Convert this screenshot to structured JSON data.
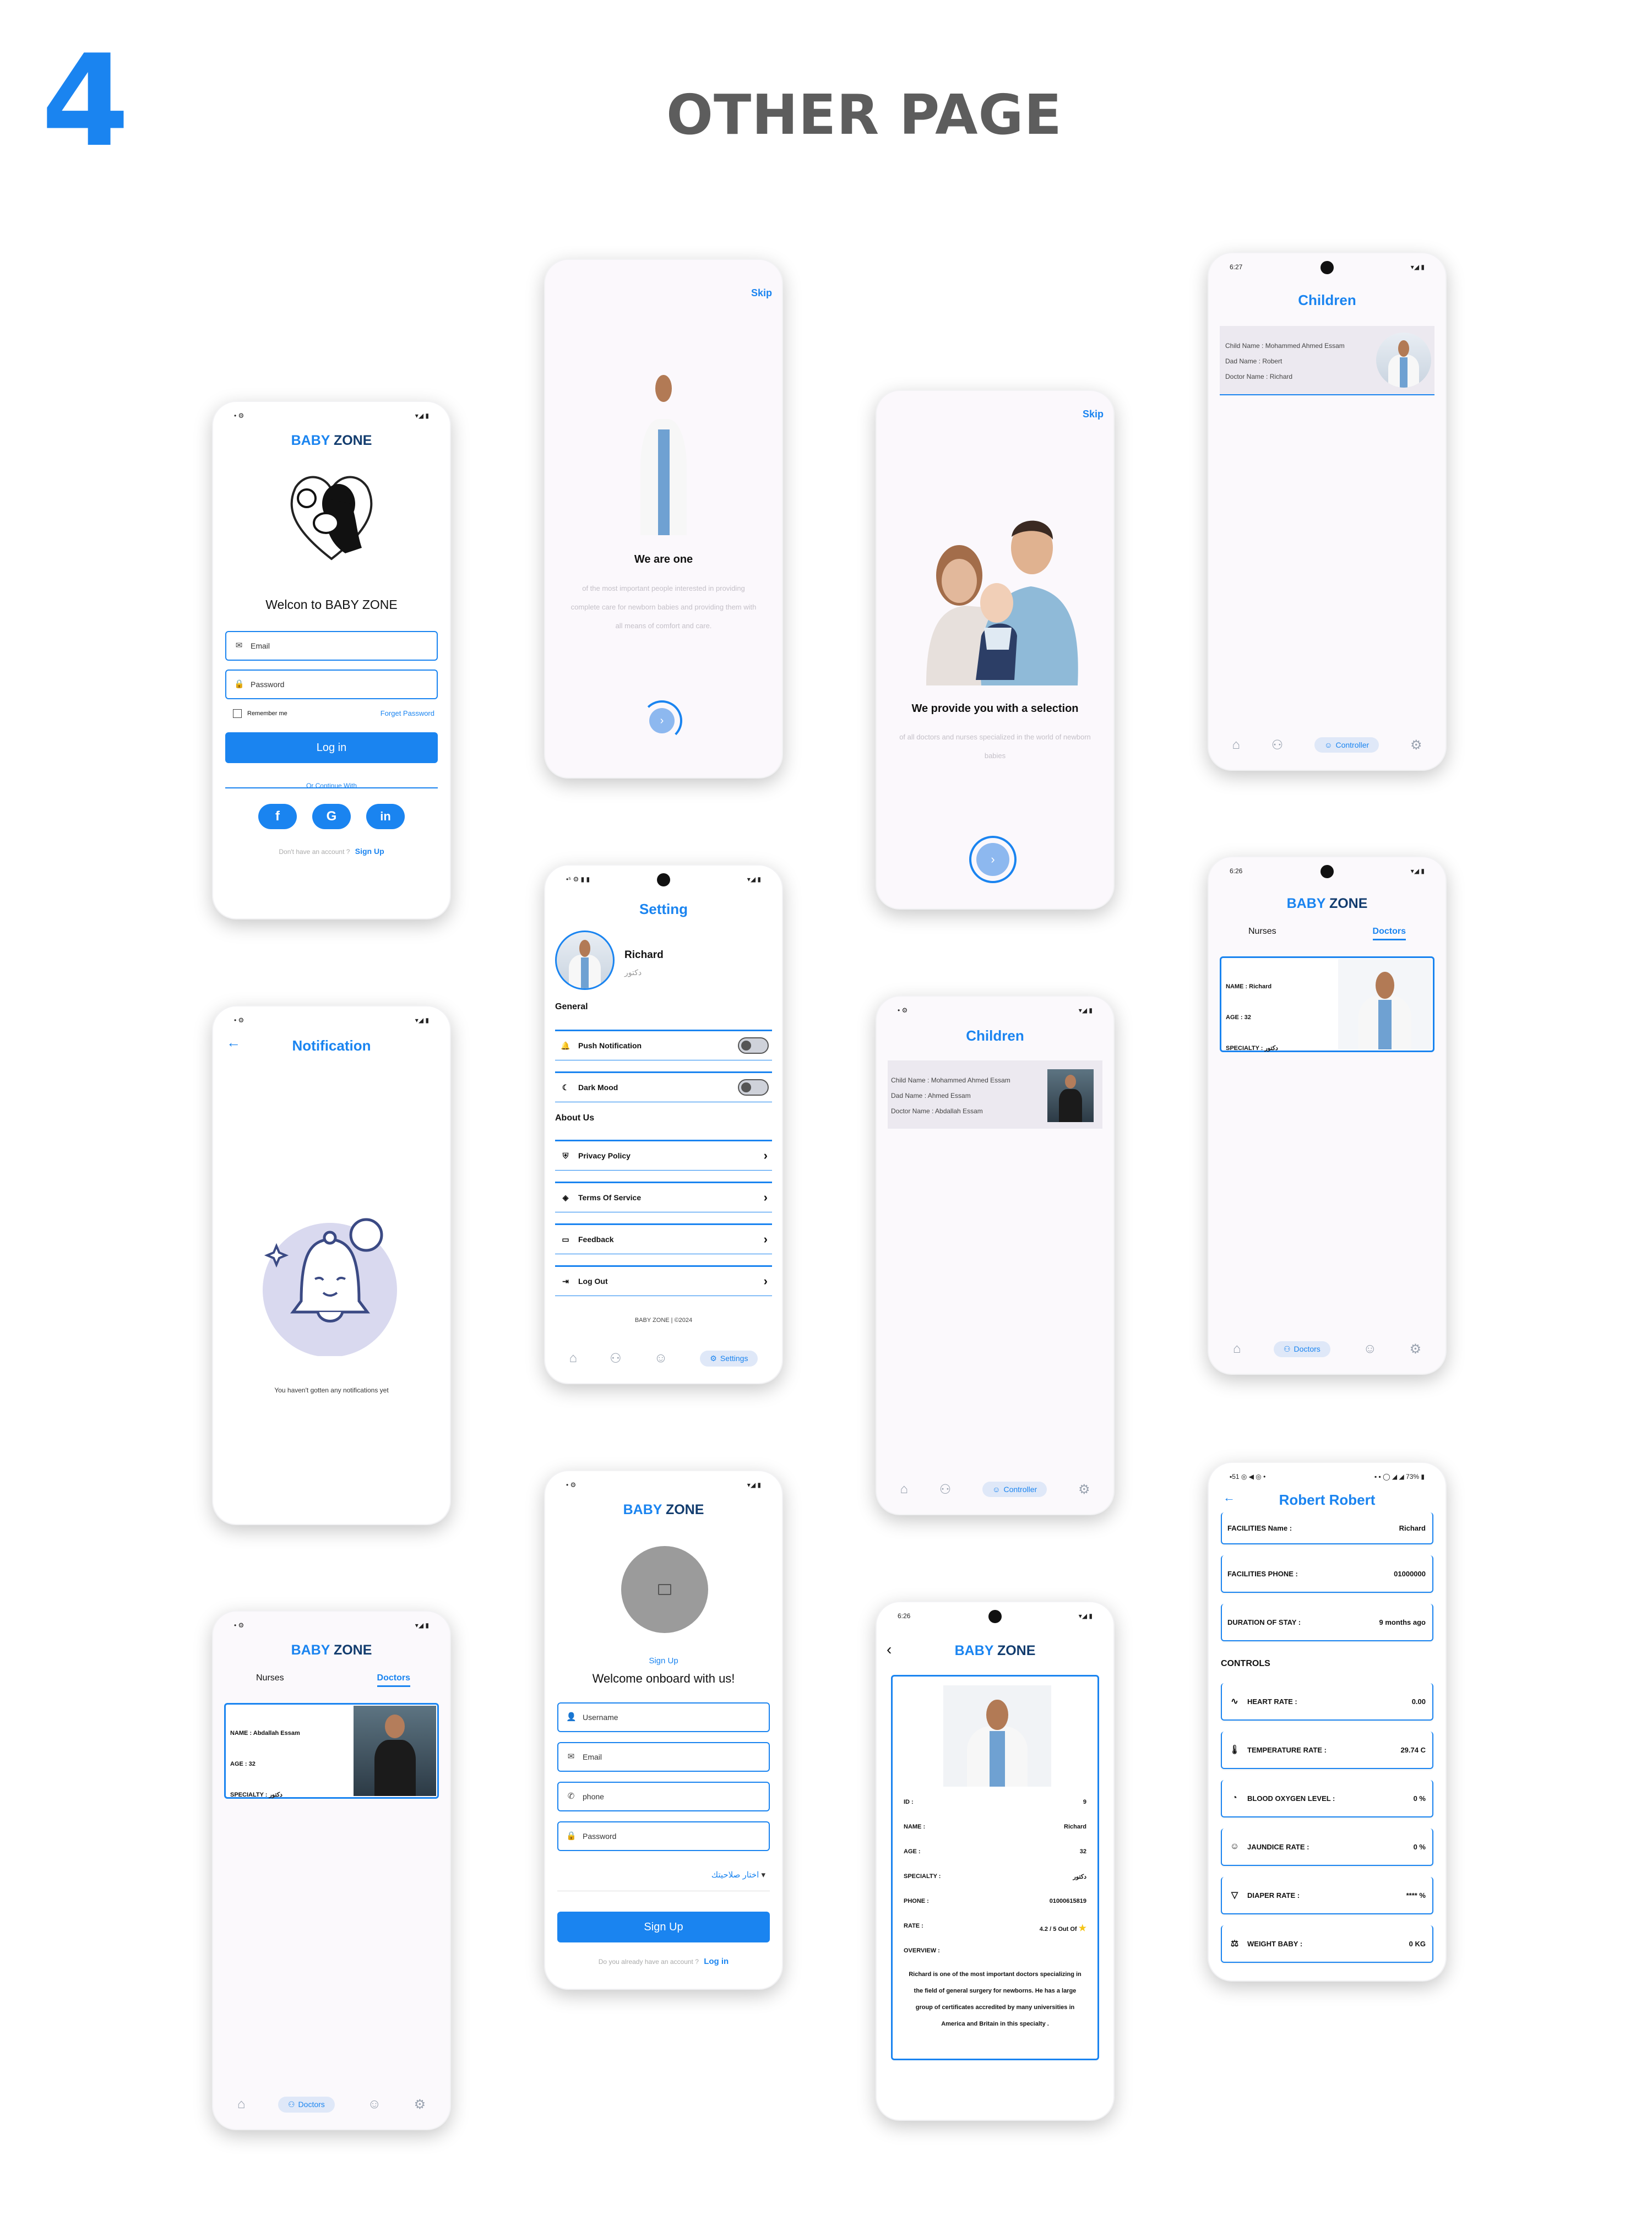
{
  "header": {
    "number": "4",
    "title": "OTHER PAGE"
  },
  "brand": {
    "part1": "BABY",
    "part2": "ZONE"
  },
  "login": {
    "welcome": "Welcon to BABY ZONE",
    "email_placeholder": "Email",
    "password_placeholder": "Password",
    "remember": "Remember me",
    "forget": "Forget Password",
    "login_btn": "Log in",
    "or_continue": "Or Continue With",
    "no_account": "Don't have an account ?",
    "sign_up": "Sign Up"
  },
  "onboard1": {
    "skip": "Skip",
    "title": "We are one",
    "text": "of the most important people interested in providing complete care for newborn babies and providing them with all means of comfort and care."
  },
  "onboard2": {
    "skip": "Skip",
    "title": "We provide you with a selection",
    "text": "of all doctors and nurses specialized in the world of newborn babies"
  },
  "children1": {
    "status_time": "6:27",
    "title": "Children",
    "child_name": "Child Name : Mohammed Ahmed Essam",
    "dad_name": "Dad Name : Robert",
    "doctor_name": "Doctor Name : Richard",
    "tab_active": "Controller"
  },
  "notification": {
    "title": "Notification",
    "empty": "You haven't gotten any notifications yet"
  },
  "settings": {
    "title": "Setting",
    "user_name": "Richard",
    "user_role": "دكتور",
    "general": "General",
    "push": "Push Notification",
    "dark": "Dark Mood",
    "about": "About Us",
    "privacy": "Privacy Policy",
    "terms": "Terms Of Service",
    "feedback": "Feedback",
    "logout": "Log Out",
    "footer": "BABY ZONE | ©2024",
    "tab_active": "Settings"
  },
  "children2": {
    "title": "Children",
    "child_name": "Child Name : Mohammed Ahmed Essam",
    "dad_name": "Dad Name : Ahmed Essam",
    "doctor_name": "Doctor Name : Abdallah Essam",
    "tab_active": "Controller"
  },
  "doctors1": {
    "status_time": "6:26",
    "tab_nurses": "Nurses",
    "tab_doctors": "Doctors",
    "name": "NAME : Richard",
    "age": "AGE : 32",
    "specialty": "SPECIALTY : دكتور",
    "tab_active": "Doctors"
  },
  "doctors2": {
    "tab_nurses": "Nurses",
    "tab_doctors": "Doctors",
    "name": "NAME : Abdallah Essam",
    "age": "AGE : 32",
    "specialty": "SPECIALTY : دكتور",
    "tab_active": "Doctors"
  },
  "signup": {
    "link": "Sign Up",
    "welcome": "Welcome onboard with us!",
    "username": "Username",
    "email": "Email",
    "phone": "phone",
    "password": "Password",
    "role_select": "اختار صلاحيتك",
    "btn": "Sign Up",
    "have_account": "Do you already have an account ?",
    "login": "Log in"
  },
  "doctor_detail": {
    "status_time": "6:26",
    "id_label": "ID :",
    "id": "9",
    "name_label": "NAME :",
    "name": "Richard",
    "age_label": "AGE :",
    "age": "32",
    "spec_label": "SPECIALTY :",
    "spec": "دكتور",
    "phone_label": "PHONE :",
    "phone": "01000615819",
    "rate_label": "RATE :",
    "rate": "4.2 / 5 Out Of",
    "overview_label": "OVERVIEW :",
    "overview": "Richard is one of the most important doctors specializing in the field of general surgery for newborns. He has a large group of certificates accredited by many universities in America and Britain in this specialty ."
  },
  "robert": {
    "title": "Robert Robert",
    "status_right": "73%",
    "fac_name_label": "FACILITIES Name :",
    "fac_name": "Richard",
    "fac_phone_label": "FACILITIES PHONE :",
    "fac_phone": "01000000",
    "stay_label": "DURATION OF STAY :",
    "stay": "9 months ago",
    "controls": "CONTROLS",
    "heart_label": "HEART RATE :",
    "heart": "0.00",
    "temp_label": "TEMPERATURE RATE :",
    "temp": "29.74 C",
    "oxygen_label": "BLOOD OXYGEN LEVEL :",
    "oxygen": "0 %",
    "jaundice_label": "JAUNDICE RATE :",
    "jaundice": "0 %",
    "diaper_label": "DIAPER RATE :",
    "diaper": "**** %",
    "weight_label": "WEIGHT BABY :",
    "weight": "0 KG"
  },
  "colors": {
    "accent": "#1a84f0",
    "title_gray": "#5d5d5d",
    "navy": "#123c6e"
  }
}
